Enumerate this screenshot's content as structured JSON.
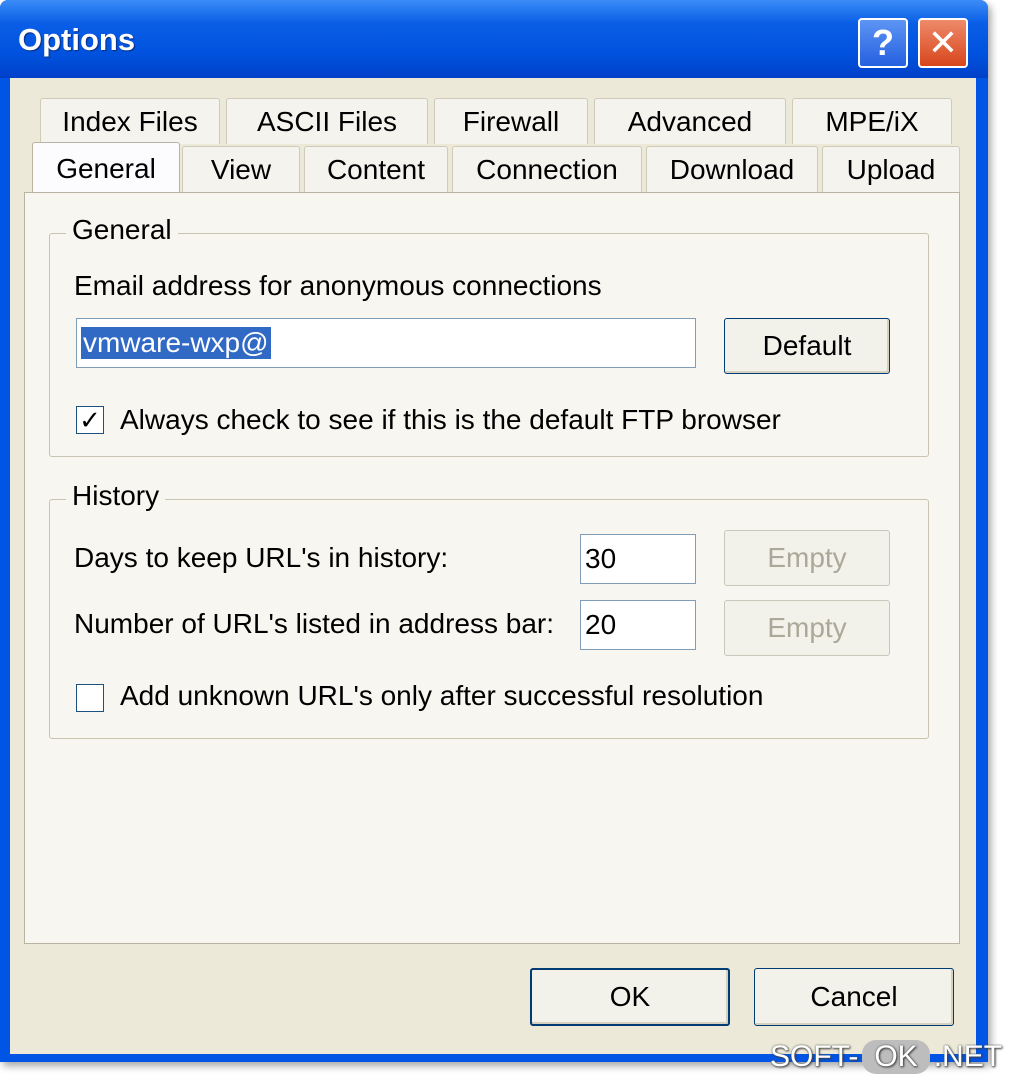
{
  "window": {
    "title": "Options",
    "help_glyph": "?",
    "close_glyph": "✕"
  },
  "tabs": {
    "back_row": [
      "Index Files",
      "ASCII Files",
      "Firewall",
      "Advanced",
      "MPE/iX"
    ],
    "front_row": [
      "General",
      "View",
      "Content",
      "Connection",
      "Download",
      "Upload"
    ],
    "active": "General"
  },
  "general": {
    "group_label": "General",
    "email_label": "Email address for anonymous connections",
    "email_value": "vmware-wxp@",
    "default_button": "Default",
    "check_default_label": "Always check to see if this is the default FTP browser",
    "check_default_checked": true
  },
  "history": {
    "group_label": "History",
    "days_label": "Days to keep URL's in history:",
    "days_value": "30",
    "days_empty_button": "Empty",
    "count_label": "Number of URL's listed in address bar:",
    "count_value": "20",
    "count_empty_button": "Empty",
    "unknown_label": "Add unknown URL's only after successful resolution",
    "unknown_checked": false
  },
  "footer": {
    "ok_button": "OK",
    "cancel_button": "Cancel"
  },
  "watermark": {
    "left": "SOFT-",
    "middle": "OK",
    "right": ".NET"
  },
  "colors": {
    "titlebar": "#0055e5",
    "client": "#ece9d8",
    "selection": "#316ac5",
    "close_button": "#d8461c"
  }
}
